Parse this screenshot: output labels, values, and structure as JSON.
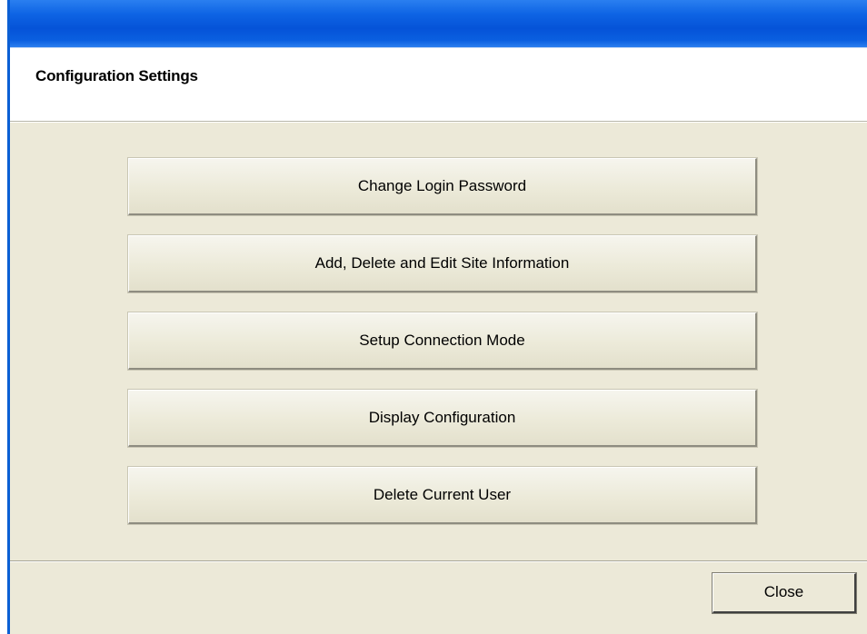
{
  "dialog": {
    "title": "Configuration Settings"
  },
  "buttons": [
    {
      "label": "Change Login Password"
    },
    {
      "label": "Add, Delete and Edit Site Information"
    },
    {
      "label": "Setup Connection Mode"
    },
    {
      "label": "Display Configuration"
    },
    {
      "label": "Delete Current User"
    }
  ],
  "footer": {
    "close_label": "Close"
  },
  "colors": {
    "title_bar": "#0553d8",
    "dialog_bg": "#ece9d8",
    "header_bg": "#ffffff"
  }
}
